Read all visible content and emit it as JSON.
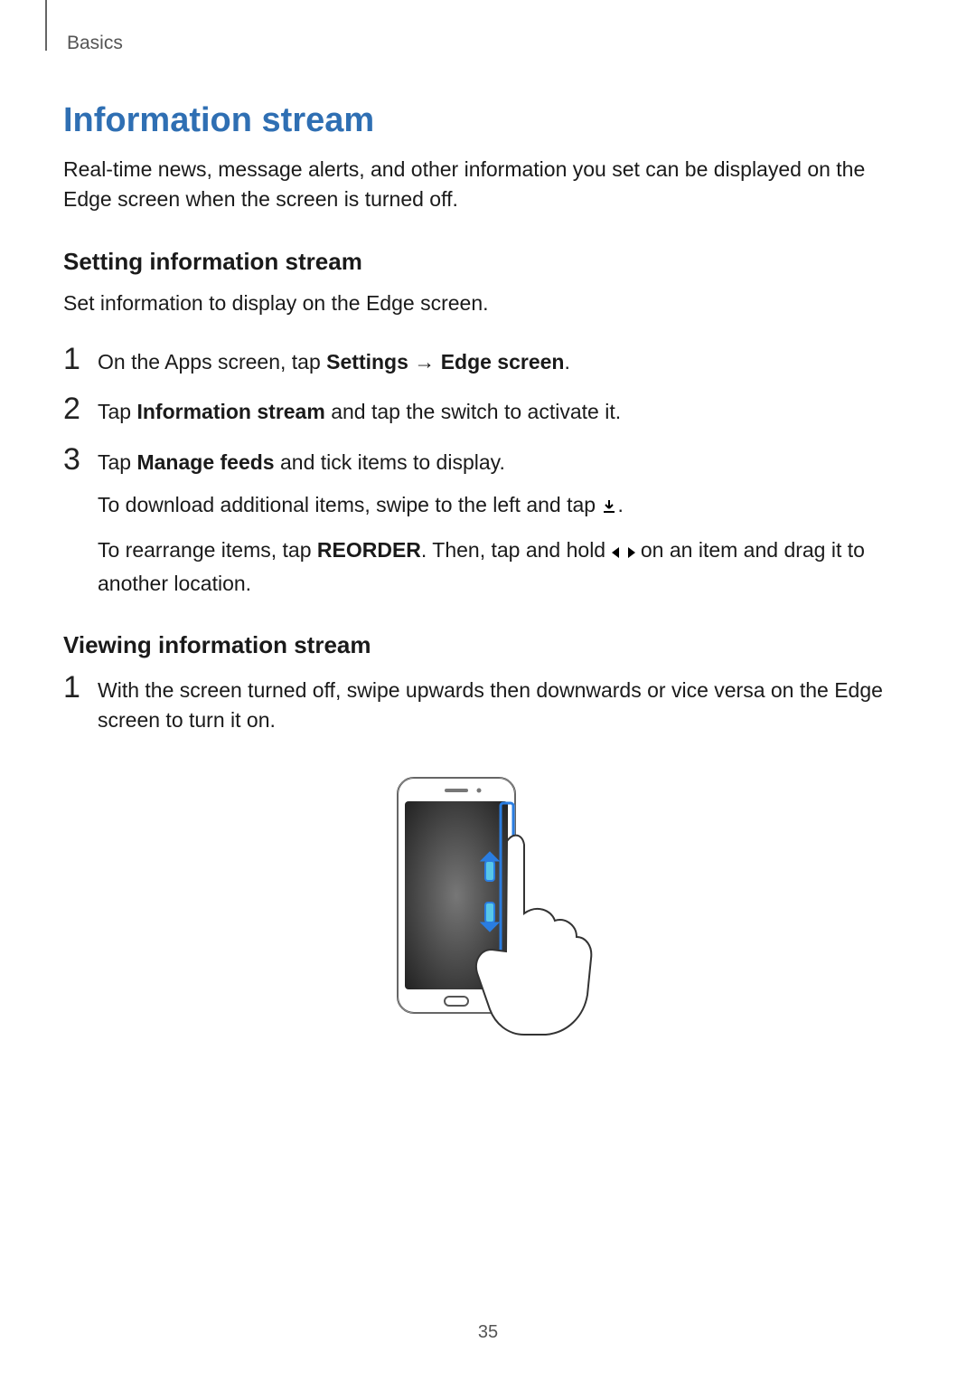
{
  "chapter": "Basics",
  "title": "Information stream",
  "intro": "Real-time news, message alerts, and other information you set can be displayed on the Edge screen when the screen is turned off.",
  "section1": {
    "heading": "Setting information stream",
    "lead": "Set information to display on the Edge screen.",
    "steps": [
      {
        "num": "1",
        "pre": "On the Apps screen, tap ",
        "bold1": "Settings",
        "mid": " → ",
        "bold2": "Edge screen",
        "post": "."
      },
      {
        "num": "2",
        "pre": "Tap ",
        "bold1": "Information stream",
        "post": " and tap the switch to activate it."
      },
      {
        "num": "3",
        "pre": "Tap ",
        "bold1": "Manage feeds",
        "post": " and tick items to display.",
        "sub1_pre": "To download additional items, swipe to the left and tap ",
        "sub1_post": ".",
        "sub2_pre": "To rearrange items, tap ",
        "sub2_bold": "REORDER",
        "sub2_mid": ". Then, tap and hold ",
        "sub2_post": " on an item and drag it to another location."
      }
    ]
  },
  "section2": {
    "heading": "Viewing information stream",
    "steps": [
      {
        "num": "1",
        "text": "With the screen turned off, swipe upwards then downwards or vice versa on the Edge screen to turn it on."
      }
    ]
  },
  "page_number": "35"
}
